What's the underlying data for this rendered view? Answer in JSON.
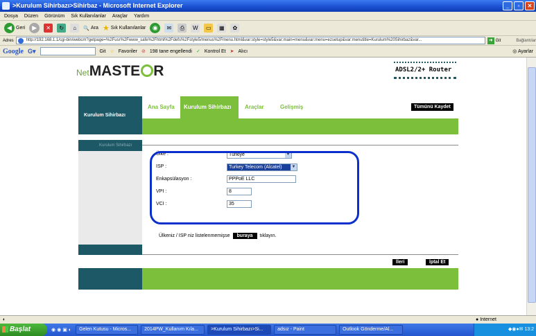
{
  "window": {
    "title": ">Kurulum Sihirbazı>Sihirbaz - Microsoft Internet Explorer"
  },
  "menu": [
    "Dosya",
    "Düzen",
    "Görünüm",
    "Sık Kullanılanlar",
    "Araçlar",
    "Yardım"
  ],
  "toolbar": {
    "back": "Geri",
    "search": "Ara",
    "favorites": "Sık Kullanılanlar"
  },
  "address": {
    "label": "Adres",
    "url": "http://192.168.1.1/cgi-bin/webcm?getpage=%2Fusr%2Fwww_safe%2Fhtml%2Fdefs%2Fstyle5/menus%2Fmenu.html&var:style=style5&var:main=menu&var:menu=ezsetup&var:menutitle=Kurulum%20Sihirbaz&var...",
    "go": "Git",
    "links": "Bağlantılar"
  },
  "googlebar": {
    "logo": "Google",
    "git": "Git",
    "favorites": "Favoriler",
    "blocked": "198 tane engellendi",
    "check": "Kontrol Et",
    "send": "Alıcı",
    "settings": "Ayarlar"
  },
  "page": {
    "brand_net": "Net",
    "brand_master": "MASTE",
    "brand_r": "R",
    "router_label": "ADSL2/2+ Router",
    "side_title": "Kurulum Sihirbazı",
    "tabs": [
      "Ana Sayfa",
      "Kurulum Sihirbazı",
      "Araçlar",
      "Gelişmiş"
    ],
    "save_all": "Tümünü Kaydet",
    "sidebar_item": "Kurulum Sihirbazı",
    "form": {
      "country_label": "Ülke :",
      "country_value": "Türkiye",
      "isp_label": "ISP :",
      "isp_value": "Turkey Telecom (Alcatel)",
      "encap_label": "Enkapsülasyon :",
      "encap_value": "PPPoE LLC",
      "vpi_label": "VPI :",
      "vpi_value": "8",
      "vci_label": "VCI :",
      "vci_value": "35"
    },
    "isp_note_before": "Ülkeniz / ISP niz listelenmemişse",
    "isp_note_button": "buraya",
    "isp_note_after": "tıklayın.",
    "next": "İleri",
    "cancel": "İptal Et"
  },
  "status": {
    "zone": "Internet"
  },
  "taskbar": {
    "start": "Başlat",
    "tasks": [
      "Gelen Kutusu - Micros...",
      "2014PW_Kullanım Kıla...",
      ">Kurulum Sihirbazı>Si...",
      "adsız - Paint",
      "Outlook Gönderme/Al..."
    ],
    "clock": "13:2"
  },
  "colors": {
    "green": "#7bbf3a",
    "teal": "#1c5866",
    "annotation": "#0a2fcc"
  }
}
